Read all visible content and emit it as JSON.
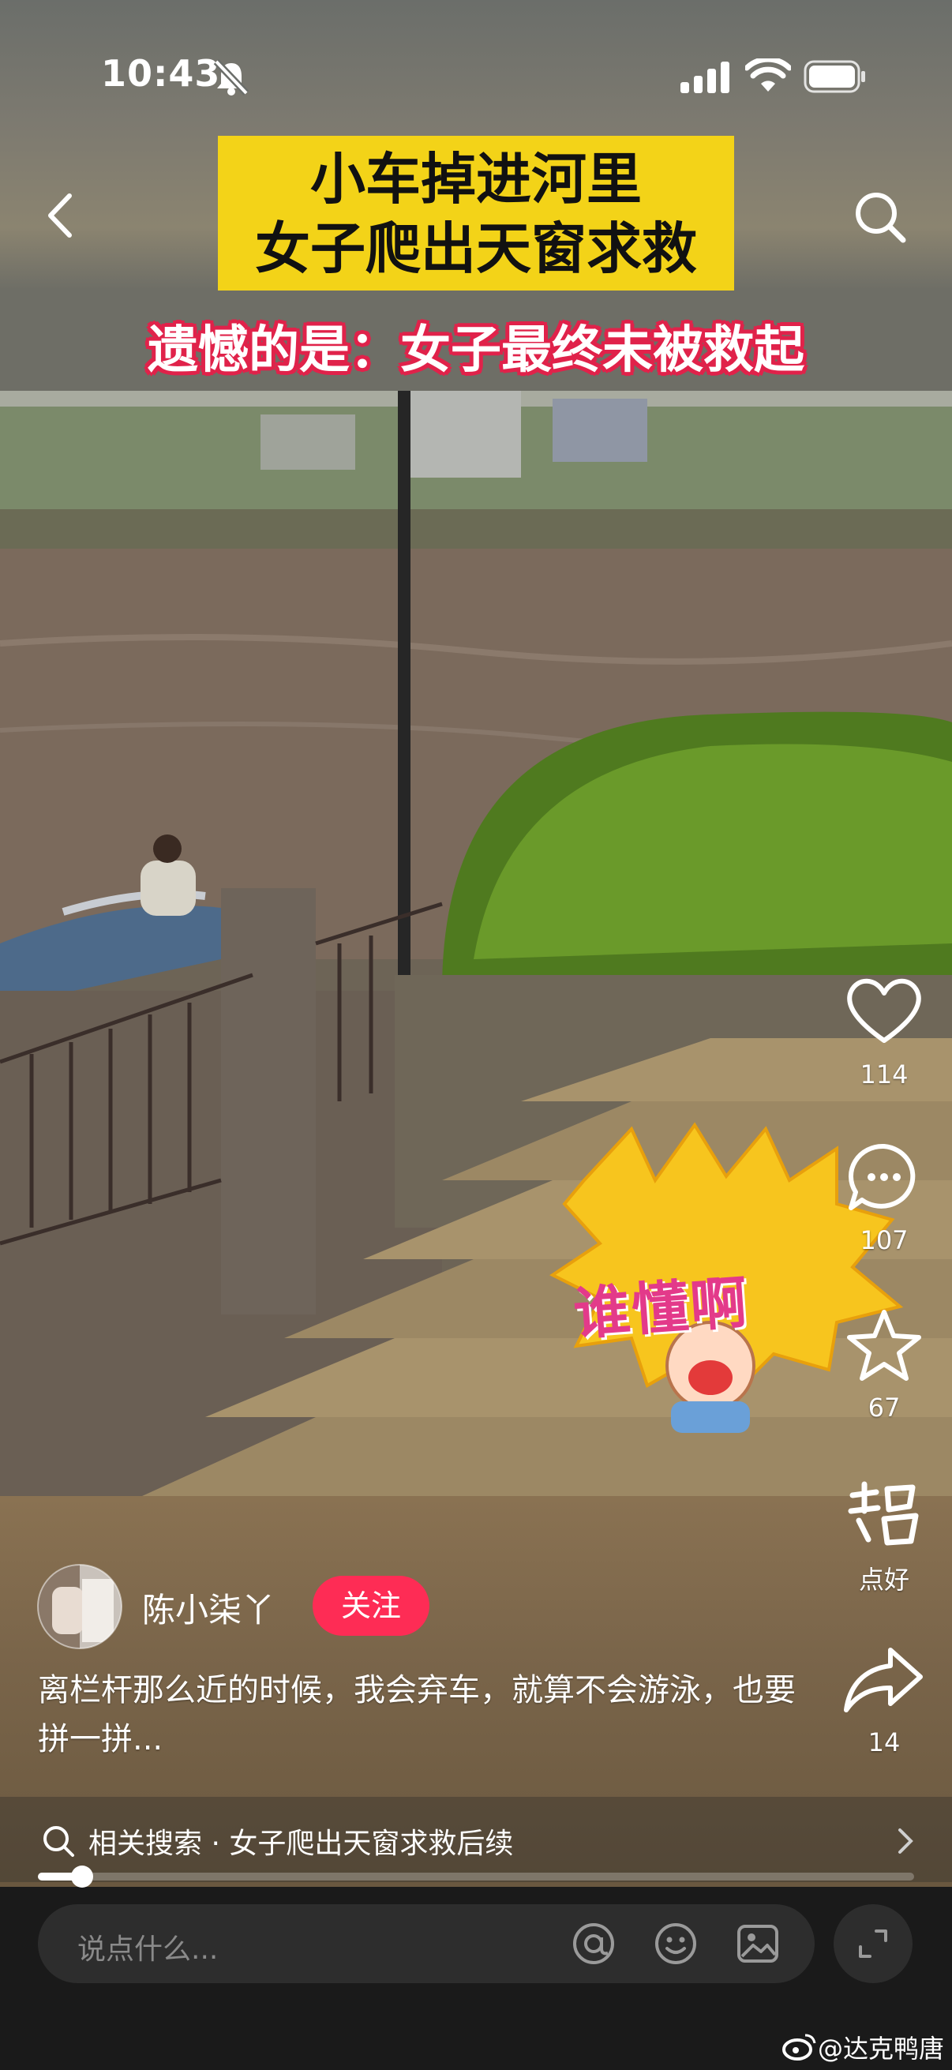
{
  "status_bar": {
    "time": "10:43"
  },
  "video": {
    "caption_line1": "小车掉进河里",
    "caption_line2": "女子爬出天窗求救",
    "subcaption": "遗憾的是：女子最终未被救起",
    "sticker_text": "谁懂啊"
  },
  "actions": {
    "like_count": "114",
    "comment_count": "107",
    "favorite_count": "67",
    "good_label": "点好",
    "share_count": "14"
  },
  "author": {
    "name": "陈小柒丫",
    "follow_label": "关注"
  },
  "description": "离栏杆那么近的时候，我会弃车，就算不会游泳，也要拼一拼...",
  "related_search": {
    "text": "相关搜索 · 女子爬出天窗求救后续"
  },
  "progress": {
    "played_fraction": 0.05
  },
  "comment_input": {
    "placeholder": "说点什么..."
  },
  "watermark": "@达克鸭唐",
  "colors": {
    "follow_red": "#fe2c55",
    "caption_yellow": "#f3d318",
    "subcaption_red": "#e0224a"
  }
}
